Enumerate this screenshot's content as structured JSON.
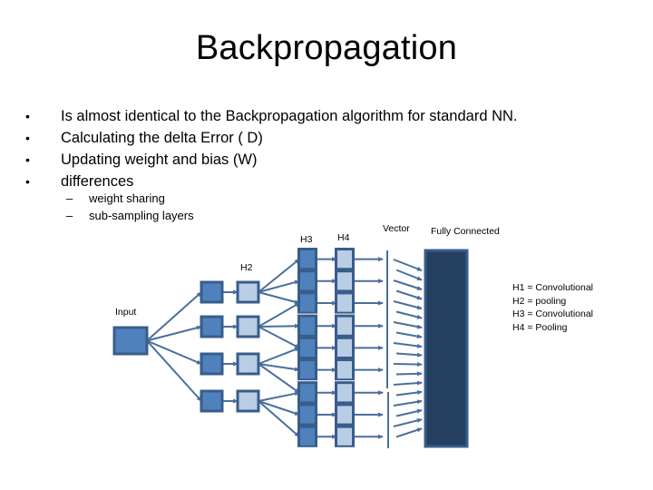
{
  "slide": {
    "title": "Backpropagation",
    "bullets": [
      {
        "marker": "•",
        "text": "Is almost identical to the Backpropagation algorithm for standard NN."
      },
      {
        "marker": "•",
        "text": "Calculating the delta Error   ( D)"
      },
      {
        "marker": "•",
        "text": "Updating weight and bias   (W)"
      },
      {
        "marker": "•",
        "text": "differences"
      }
    ],
    "sub_bullets": [
      {
        "marker": "–",
        "text": "weight sharing"
      },
      {
        "marker": "–",
        "text": "sub-sampling layers"
      }
    ]
  },
  "diagram": {
    "labels": {
      "input": "Input",
      "h2": "H2",
      "h3": "H3",
      "h4": "H4",
      "vector": "Vector",
      "fully_connected": "Fully Connected"
    },
    "legend": [
      "H1 = Convolutional",
      "H2 = pooling",
      "H3 = Convolutional",
      "H4 = Pooling"
    ],
    "structure": {
      "input_nodes": 1,
      "h1_nodes": 4,
      "h2_nodes": 4,
      "h3_groups": 3,
      "h3_nodes_per_group": 3,
      "h4_nodes": 9,
      "vector_arrows": 18
    },
    "colors": {
      "node_dark": "#4f81bd",
      "node_light": "#b9cde5",
      "border": "#385d8a",
      "arrow": "#4a6f9c",
      "fully_connected": "#243f60"
    }
  }
}
